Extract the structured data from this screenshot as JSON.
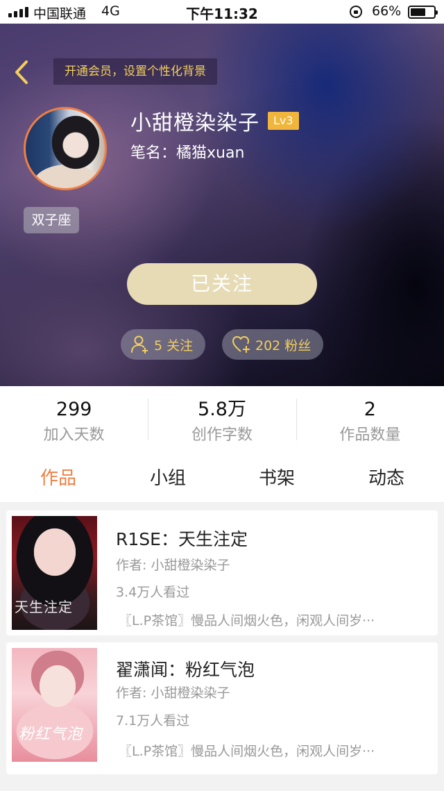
{
  "status_bar": {
    "carrier": "中国联通",
    "network": "4G",
    "time": "下午11:32",
    "battery": "66%",
    "battery_level": 0.66
  },
  "header": {
    "vip_banner": "开通会员，设置个性化背景",
    "nickname": "小甜橙染染子",
    "level": "Lv3",
    "pen_name": "笔名：橘猫xuan",
    "constellation": "双子座",
    "follow_button": "已关注",
    "following": "5 关注",
    "fans": "202 粉丝",
    "accent_color": "#f3cf5d"
  },
  "stats": [
    {
      "value": "299",
      "label": "加入天数"
    },
    {
      "value": "5.8万",
      "label": "创作字数"
    },
    {
      "value": "2",
      "label": "作品数量"
    }
  ],
  "tabs": {
    "active": "作品",
    "items": [
      "作品",
      "小组",
      "书架",
      "动态"
    ],
    "active_color": "#f07f43"
  },
  "books": [
    {
      "title": "R1SE：天生注定",
      "author": "作者: 小甜橙染染子",
      "views": "3.4万人看过",
      "description": "〖L.P茶馆〗慢品人间烟火色，闲观人间岁···",
      "cover_text": "天生注定"
    },
    {
      "title": "翟潇闻：粉红气泡",
      "author": "作者: 小甜橙染染子",
      "views": "7.1万人看过",
      "description": "〖L.P茶馆〗慢品人间烟火色，闲观人间岁···",
      "cover_text": "粉红气泡"
    }
  ],
  "icons": {
    "back": "chevron-left-icon",
    "following": "add-user-icon",
    "fans": "heart-plus-icon",
    "status_lock": "rotation-lock-icon"
  }
}
